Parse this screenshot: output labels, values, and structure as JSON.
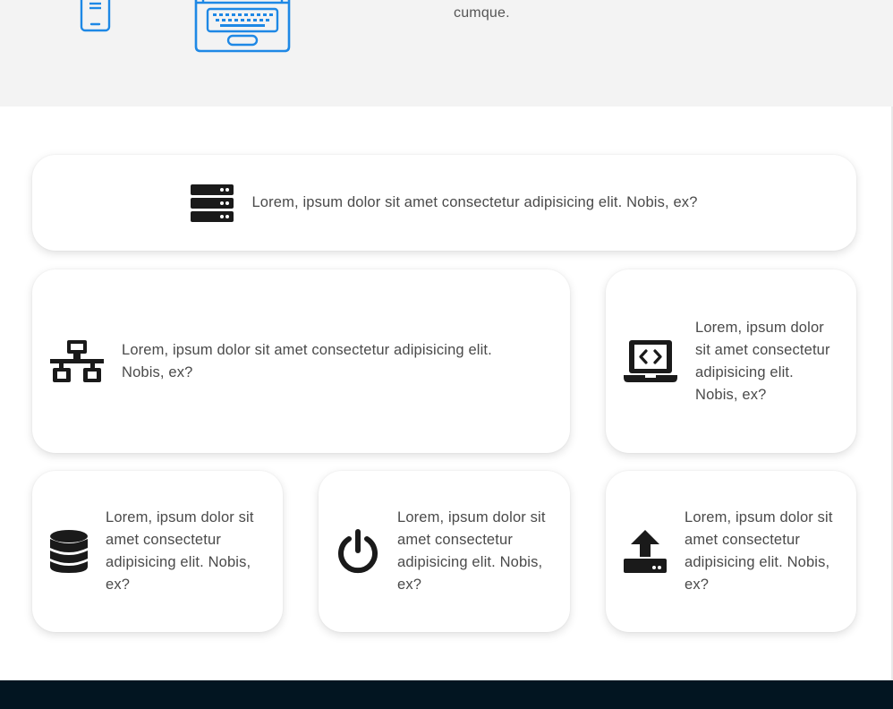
{
  "hero": {
    "text": "cumque.",
    "icons": [
      "phone-icon",
      "laptop-outline-icon"
    ],
    "icon_color": "#1e88e5"
  },
  "features": [
    {
      "icon": "server-icon",
      "text": "Lorem, ipsum dolor sit amet consectetur adipisicing elit. Nobis, ex?"
    },
    {
      "icon": "network-icon",
      "text": "Lorem, ipsum dolor sit amet consectetur adipisicing elit. Nobis, ex?"
    },
    {
      "icon": "laptop-code-icon",
      "text": "Lorem, ipsum dolor sit amet consectetur adipisicing elit. Nobis, ex?"
    },
    {
      "icon": "database-icon",
      "text": "Lorem, ipsum dolor sit amet consectetur adipisicing elit. Nobis, ex?"
    },
    {
      "icon": "power-icon",
      "text": "Lorem, ipsum dolor sit amet consectetur adipisicing elit. Nobis, ex?"
    },
    {
      "icon": "upload-icon",
      "text": "Lorem, ipsum dolor sit amet consectetur adipisicing elit. Nobis, ex?"
    }
  ],
  "colors": {
    "hero_bg": "#f3f3f3",
    "footer_bg": "#021521",
    "icon_dark": "#1a1a1a"
  }
}
